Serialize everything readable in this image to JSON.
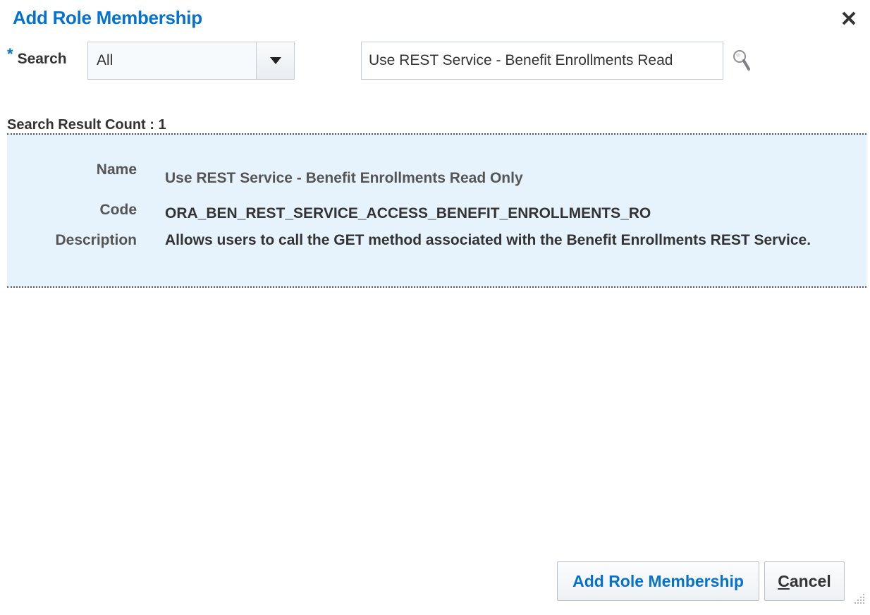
{
  "dialog": {
    "title": "Add Role Membership",
    "close_icon": "close-icon"
  },
  "search": {
    "required_marker": "*",
    "label": "Search",
    "category_selected": "All",
    "query_value": "Use REST Service - Benefit Enrollments Read",
    "search_icon": "magnifier-icon"
  },
  "results": {
    "count_label": "Search Result Count : 1",
    "items": [
      {
        "name_label": "Name",
        "name_value": "Use REST Service - Benefit Enrollments Read Only",
        "code_label": "Code",
        "code_value": "ORA_BEN_REST_SERVICE_ACCESS_BENEFIT_ENROLLMENTS_RO",
        "description_label": "Description",
        "description_value": "Allows users to call the GET method associated with the Benefit Enrollments REST Service."
      }
    ]
  },
  "footer": {
    "add_button_label": "Add Role Membership",
    "cancel_button_first_letter": "C",
    "cancel_button_rest": "ancel"
  },
  "colors": {
    "accent": "#0572ce",
    "selected_row_bg": "#e6f2fc",
    "text": "#333333"
  }
}
